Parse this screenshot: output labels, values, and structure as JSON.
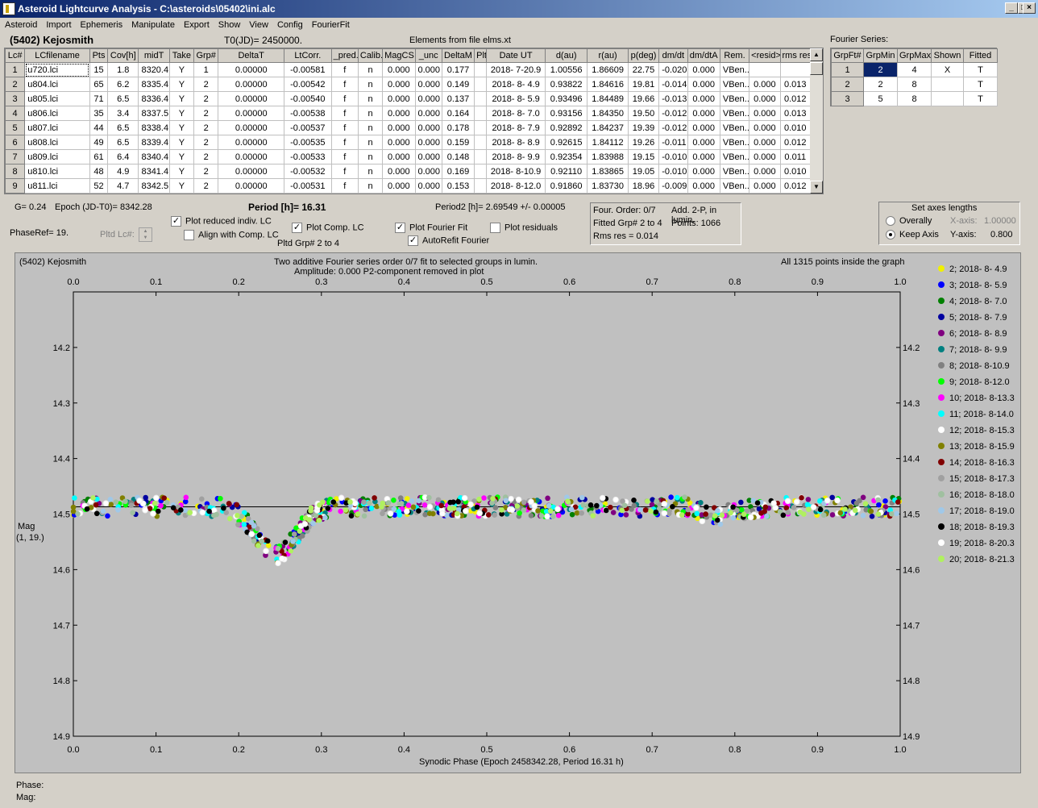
{
  "window": {
    "title": "Asteroid Lightcurve Analysis - C:\\asteroids\\05402\\ini.alc"
  },
  "menu": [
    "Asteroid",
    "Import",
    "Ephemeris",
    "Manipulate",
    "Export",
    "Show",
    "View",
    "Config",
    "FourierFit"
  ],
  "header": {
    "asteroid": "(5402) Kejosmith",
    "t0": "T0(JD)= 2450000.",
    "elements": "Elements from file elms.xt",
    "fourier_label": "Fourier Series:"
  },
  "lc_table": {
    "columns": [
      "Lc#",
      "LCfilename",
      "Pts",
      "Cov[h]",
      "midT",
      "Take",
      "Grp#",
      "DeltaT",
      "LtCorr.",
      "_pred.",
      "Calib.",
      "MagCS",
      "_unc",
      "DeltaM",
      "Plt",
      "Date UT",
      "d(au)",
      "r(au)",
      "p(deg)",
      "dm/dt",
      "dm/dtA",
      "Rem.",
      "<resid>",
      "rms res"
    ],
    "rows": [
      [
        "1",
        "u720.lci",
        "15",
        "1.8",
        "8320.4",
        "Y",
        "1",
        "0.00000",
        "-0.00581",
        "f",
        "n",
        "0.000",
        "0.000",
        "0.177",
        "",
        "2018- 7-20.9",
        "1.00556",
        "1.86609",
        "22.75",
        "-0.020",
        "0.000",
        "VBen..",
        "",
        ""
      ],
      [
        "2",
        "u804.lci",
        "65",
        "6.2",
        "8335.4",
        "Y",
        "2",
        "0.00000",
        "-0.00542",
        "f",
        "n",
        "0.000",
        "0.000",
        "0.149",
        "",
        "2018- 8- 4.9",
        "0.93822",
        "1.84616",
        "19.81",
        "-0.014",
        "0.000",
        "VBen..",
        "0.000",
        "0.013"
      ],
      [
        "3",
        "u805.lci",
        "71",
        "6.5",
        "8336.4",
        "Y",
        "2",
        "0.00000",
        "-0.00540",
        "f",
        "n",
        "0.000",
        "0.000",
        "0.137",
        "",
        "2018- 8- 5.9",
        "0.93496",
        "1.84489",
        "19.66",
        "-0.013",
        "0.000",
        "VBen..",
        "0.000",
        "0.012"
      ],
      [
        "4",
        "u806.lci",
        "35",
        "3.4",
        "8337.5",
        "Y",
        "2",
        "0.00000",
        "-0.00538",
        "f",
        "n",
        "0.000",
        "0.000",
        "0.164",
        "",
        "2018- 8- 7.0",
        "0.93156",
        "1.84350",
        "19.50",
        "-0.012",
        "0.000",
        "VBen..",
        "0.000",
        "0.013"
      ],
      [
        "5",
        "u807.lci",
        "44",
        "6.5",
        "8338.4",
        "Y",
        "2",
        "0.00000",
        "-0.00537",
        "f",
        "n",
        "0.000",
        "0.000",
        "0.178",
        "",
        "2018- 8- 7.9",
        "0.92892",
        "1.84237",
        "19.39",
        "-0.012",
        "0.000",
        "VBen..",
        "0.000",
        "0.010"
      ],
      [
        "6",
        "u808.lci",
        "49",
        "6.5",
        "8339.4",
        "Y",
        "2",
        "0.00000",
        "-0.00535",
        "f",
        "n",
        "0.000",
        "0.000",
        "0.159",
        "",
        "2018- 8- 8.9",
        "0.92615",
        "1.84112",
        "19.26",
        "-0.011",
        "0.000",
        "VBen..",
        "0.000",
        "0.012"
      ],
      [
        "7",
        "u809.lci",
        "61",
        "6.4",
        "8340.4",
        "Y",
        "2",
        "0.00000",
        "-0.00533",
        "f",
        "n",
        "0.000",
        "0.000",
        "0.148",
        "",
        "2018- 8- 9.9",
        "0.92354",
        "1.83988",
        "19.15",
        "-0.010",
        "0.000",
        "VBen..",
        "0.000",
        "0.011"
      ],
      [
        "8",
        "u810.lci",
        "48",
        "4.9",
        "8341.4",
        "Y",
        "2",
        "0.00000",
        "-0.00532",
        "f",
        "n",
        "0.000",
        "0.000",
        "0.169",
        "",
        "2018- 8-10.9",
        "0.92110",
        "1.83865",
        "19.05",
        "-0.010",
        "0.000",
        "VBen..",
        "0.000",
        "0.010"
      ],
      [
        "9",
        "u811.lci",
        "52",
        "4.7",
        "8342.5",
        "Y",
        "2",
        "0.00000",
        "-0.00531",
        "f",
        "n",
        "0.000",
        "0.000",
        "0.153",
        "",
        "2018- 8-12.0",
        "0.91860",
        "1.83730",
        "18.96",
        "-0.009",
        "0.000",
        "VBen..",
        "0.000",
        "0.012"
      ]
    ]
  },
  "fourier_table": {
    "columns": [
      "GrpFt#",
      "GrpMin",
      "GrpMax",
      "Shown",
      "Fitted"
    ],
    "rows": [
      [
        "1",
        "2",
        "4",
        "X",
        "T"
      ],
      [
        "2",
        "2",
        "8",
        "",
        "T"
      ],
      [
        "3",
        "5",
        "8",
        "",
        "T"
      ]
    ]
  },
  "info": {
    "g": "G= 0.24",
    "epoch": "Epoch (JD-T0)= 8342.28",
    "period": "Period [h]= 16.31",
    "period2": "Period2 [h]= 2.69549 +/- 0.00005",
    "phaseref": "PhaseRef= 19.",
    "pltdlc": "Pltd Lc#:",
    "plot_reduced": "Plot reduced indiv. LC",
    "align_comp": "Align with Comp. LC",
    "plot_comp": "Plot Comp. LC",
    "pltd_grp": "Pltd Grp#  2   to   4",
    "plot_fourier": "Plot Fourier Fit",
    "autorefit": "AutoRefit Fourier",
    "plot_resid": "Plot residuals",
    "four_order": "Four. Order:  0/7",
    "add2p": "Add. 2-P, in lumin.",
    "fitted_grp": "Fitted Grp# 2 to 4",
    "points": "Points: 1066",
    "rms": "Rms res     = 0.014",
    "axes_title": "Set axes lengths",
    "overally": "Overally",
    "keep_axis": "Keep Axis",
    "xaxis_label": "X-axis:",
    "xaxis_val": "1.00000",
    "yaxis_label": "Y-axis:",
    "yaxis_val": "0.800"
  },
  "plot": {
    "name": "(5402) Kejosmith",
    "subtitle1": "Two additive Fourier series order 0/7 fit to selected groups in lumin.",
    "subtitle2": "Amplitude: 0.000                  P2-component removed in plot",
    "allpoints": "All 1315 points inside the graph",
    "ylabel1": "Mag",
    "ylabel2": "(1, 19.)",
    "xlabel": "Synodic Phase (Epoch 2458342.28, Period 16.31 h)"
  },
  "chart_data": {
    "type": "scatter",
    "xlim": [
      0.0,
      1.0
    ],
    "ylim": [
      14.9,
      14.1
    ],
    "y_inverted": true,
    "xticks": [
      "0.0",
      "0.1",
      "0.2",
      "0.3",
      "0.4",
      "0.5",
      "0.6",
      "0.7",
      "0.8",
      "0.9",
      "1.0"
    ],
    "yticks": [
      "14.2",
      "14.3",
      "14.4",
      "14.5",
      "14.6",
      "14.7",
      "14.8",
      "14.9"
    ],
    "fit_line_mag": 14.487,
    "series": [
      {
        "name": "2; 2018- 8- 4.9",
        "color": "#f0f000"
      },
      {
        "name": "3; 2018- 8- 5.9",
        "color": "#0000ff"
      },
      {
        "name": "4; 2018- 8- 7.0",
        "color": "#008000"
      },
      {
        "name": "5; 2018- 8- 7.9",
        "color": "#0000a0"
      },
      {
        "name": "6; 2018- 8- 8.9",
        "color": "#800080"
      },
      {
        "name": "7; 2018- 8- 9.9",
        "color": "#008080"
      },
      {
        "name": "8; 2018- 8-10.9",
        "color": "#808080"
      },
      {
        "name": "9; 2018- 8-12.0",
        "color": "#00ff00"
      },
      {
        "name": "10; 2018- 8-13.3",
        "color": "#ff00ff"
      },
      {
        "name": "11; 2018- 8-14.0",
        "color": "#00ffff"
      },
      {
        "name": "12; 2018- 8-15.3",
        "color": "#ffffff"
      },
      {
        "name": "13; 2018- 8-15.9",
        "color": "#808000"
      },
      {
        "name": "14; 2018- 8-16.3",
        "color": "#800000"
      },
      {
        "name": "15; 2018- 8-17.3",
        "color": "#a0a0a0"
      },
      {
        "name": "16; 2018- 8-18.0",
        "color": "#a0c0a0"
      },
      {
        "name": "17; 2018- 8-19.0",
        "color": "#a0c8e8"
      },
      {
        "name": "18; 2018- 8-19.3",
        "color": "#000000"
      },
      {
        "name": "19; 2018- 8-20.3",
        "color": "#ffffff"
      },
      {
        "name": "20; 2018- 8-21.3",
        "color": "#b0f060"
      }
    ]
  },
  "status": {
    "phase": "Phase:",
    "mag": "Mag:"
  }
}
